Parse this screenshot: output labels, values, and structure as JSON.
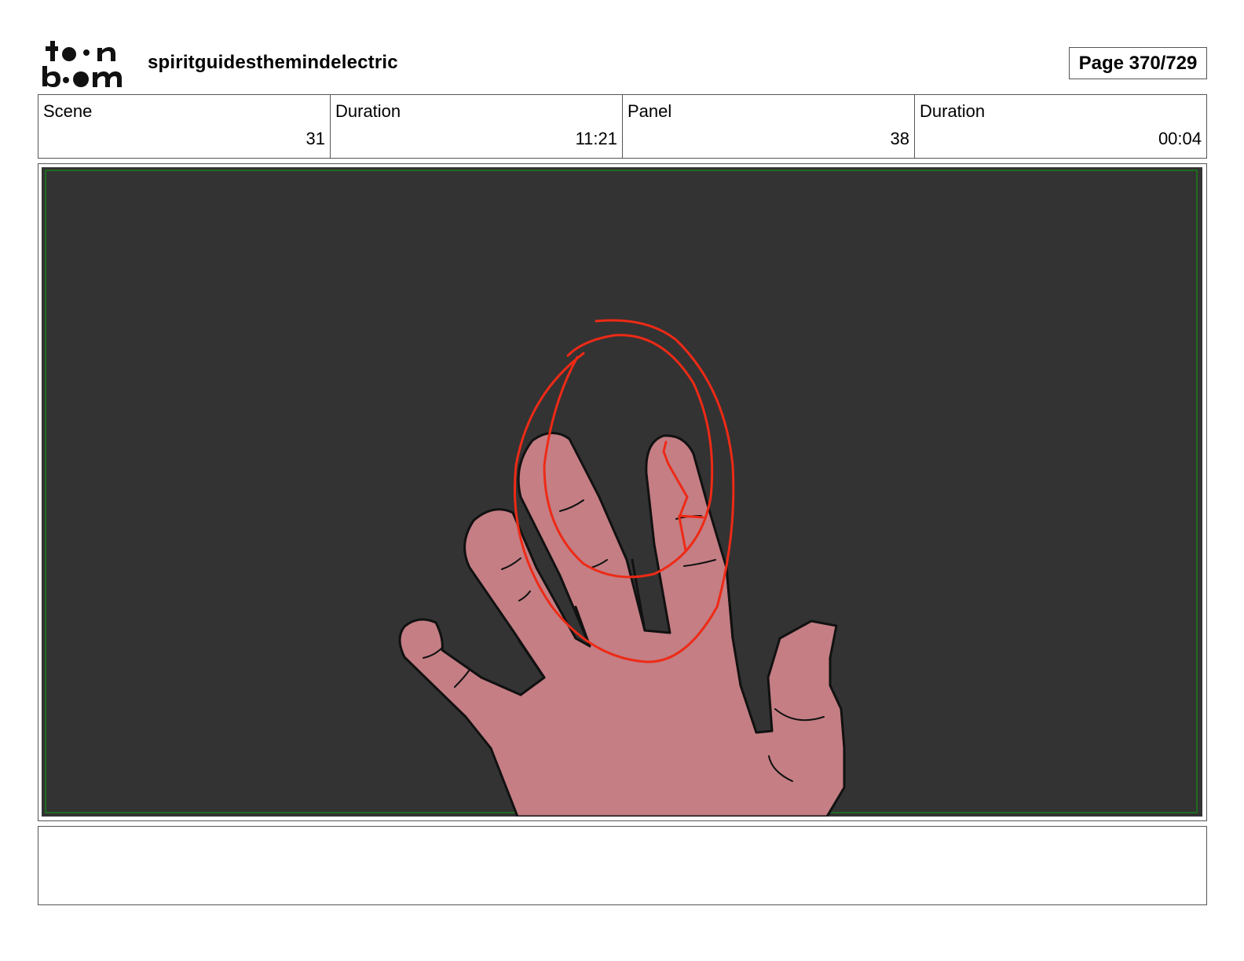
{
  "header": {
    "logo_name": "toon boom",
    "project_title": "spiritguidesthemindelectric",
    "page_label": "Page 370/729"
  },
  "info": {
    "scene_label": "Scene",
    "scene_value": "31",
    "scene_duration_label": "Duration",
    "scene_duration_value": "11:21",
    "panel_label": "Panel",
    "panel_value": "38",
    "panel_duration_label": "Duration",
    "panel_duration_value": "00:04"
  },
  "panel_image": {
    "description_icon": "hand-drawing",
    "background_color": "#333333",
    "safe_frame_color": "#1f6b1f",
    "skin_color": "#c47e84",
    "annotation_color": "#ee2a16"
  },
  "notes": {
    "text": ""
  }
}
